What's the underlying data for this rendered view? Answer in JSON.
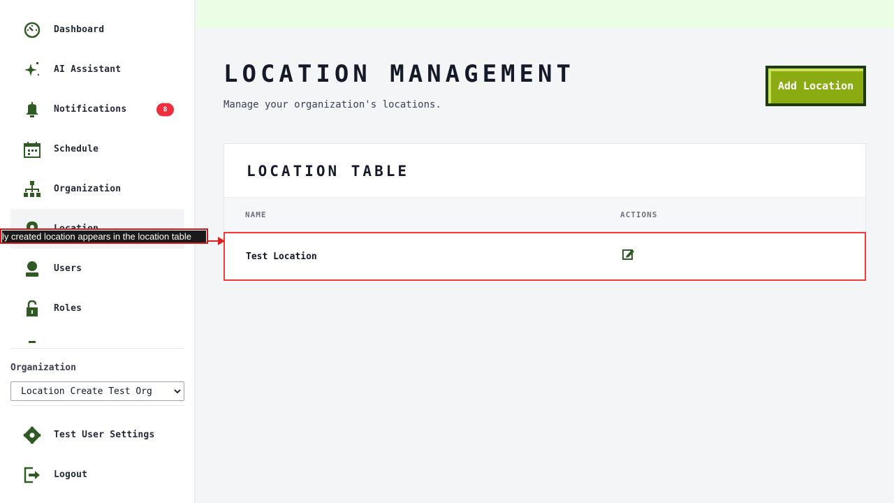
{
  "sidebar": {
    "items": [
      {
        "label": "Dashboard",
        "icon": "dashboard-icon"
      },
      {
        "label": "AI Assistant",
        "icon": "sparkle-icon"
      },
      {
        "label": "Notifications",
        "icon": "bell-icon",
        "badge": "8"
      },
      {
        "label": "Schedule",
        "icon": "calendar-icon"
      },
      {
        "label": "Organization",
        "icon": "org-chart-icon"
      },
      {
        "label": "Location",
        "icon": "location-pin-icon",
        "active": true
      },
      {
        "label": "Users",
        "icon": "user-icon"
      },
      {
        "label": "Roles",
        "icon": "lock-icon"
      }
    ],
    "org_label": "Organization",
    "org_selected": "Location Create Test Org",
    "bottom": [
      {
        "label": "Test User Settings",
        "icon": "gear-icon"
      },
      {
        "label": "Logout",
        "icon": "logout-icon"
      }
    ]
  },
  "header": {
    "title": "LOCATION MANAGEMENT",
    "subtitle": "Manage your organization's locations.",
    "add_button": "Add Location"
  },
  "table": {
    "title": "LOCATION TABLE",
    "columns": [
      "NAME",
      "ACTIONS"
    ],
    "rows": [
      {
        "name": "Test Location",
        "action_icon": "edit-icon"
      }
    ]
  },
  "annotation": {
    "text": "ly created location appears in the location table"
  },
  "colors": {
    "accent_green": "#8aab12",
    "dark_green": "#1d3a10",
    "icon_green": "#2f5a24",
    "badge_red": "#ef2e3f",
    "highlight_red": "#ef3b3b"
  }
}
